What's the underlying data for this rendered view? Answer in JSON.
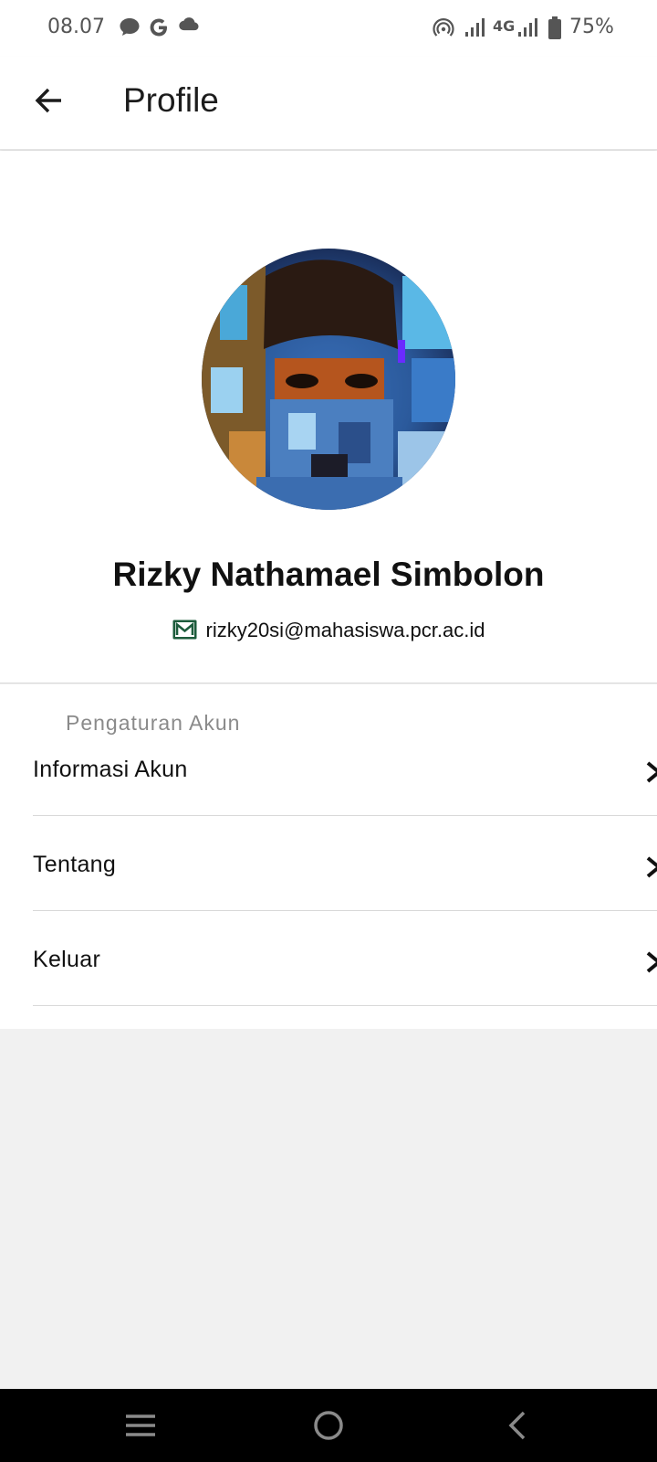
{
  "status_bar": {
    "time": "08.07",
    "network": "4G",
    "battery": "75%",
    "icons": [
      "message-icon",
      "google-icon",
      "cloud-icon",
      "hotspot-icon",
      "signal-icon",
      "signal-icon",
      "battery-icon"
    ]
  },
  "app_bar": {
    "title": "Profile",
    "back_icon": "arrow-left-icon"
  },
  "profile": {
    "name": "Rizky Nathamael Simbolon",
    "email": "rizky20si@mahasiswa.pcr.ac.id",
    "email_icon": "gmail-icon"
  },
  "settings": {
    "section_title": "Pengaturan Akun",
    "items": [
      {
        "label": "Informasi Akun",
        "icon": "chevron-right-icon"
      },
      {
        "label": "Tentang",
        "icon": "chevron-right-icon"
      },
      {
        "label": "Keluar",
        "icon": "chevron-right-icon"
      }
    ]
  },
  "nav_bar": {
    "buttons": [
      "menu-icon",
      "home-icon",
      "back-icon"
    ]
  },
  "colors": {
    "background": "#f1f1f1",
    "surface": "#ffffff",
    "nav_bar": "#000000",
    "muted_text": "#8a8a8a",
    "mail_icon_green": "#1d5c3c"
  }
}
